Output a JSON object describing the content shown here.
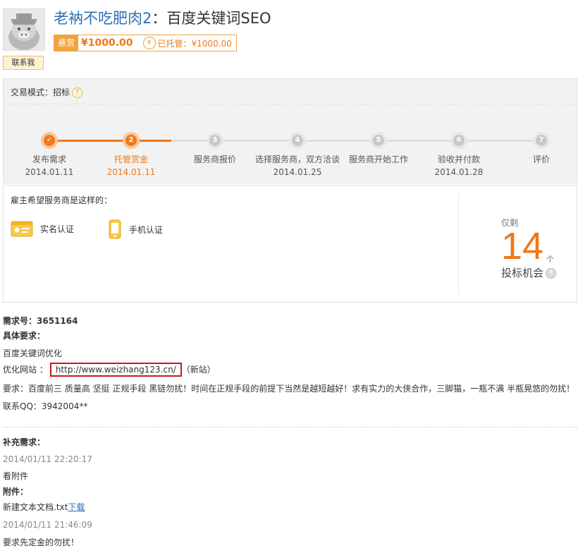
{
  "header": {
    "username": "老衲不吃肥肉2",
    "title_sep": "：",
    "task_title": "百度关键词SEO",
    "contact_label": "联系我",
    "reward_tag": "悬赏",
    "reward_amount": "¥1000.00",
    "escrow_icon_char": "¥",
    "escrow_text": "已托管：¥1000.00"
  },
  "process": {
    "mode_label": "交易模式：招标",
    "steps": [
      {
        "num": "✓",
        "label": "发布需求",
        "date": "2014.01.11",
        "state": "done"
      },
      {
        "num": "2",
        "label": "托管赏金",
        "date": "2014.01.11",
        "state": "active"
      },
      {
        "num": "3",
        "label": "服务商报价",
        "date": "",
        "state": "pending"
      },
      {
        "num": "4",
        "label": "选择服务商，双方洽谈",
        "date": "2014.01.25",
        "state": "pending"
      },
      {
        "num": "5",
        "label": "服务商开始工作",
        "date": "",
        "state": "pending"
      },
      {
        "num": "6",
        "label": "验收并付款",
        "date": "2014.01.28",
        "state": "pending"
      },
      {
        "num": "7",
        "label": "评价",
        "date": "",
        "state": "pending"
      }
    ]
  },
  "requirements": {
    "heading": "雇主希望服务商是这样的：",
    "certs": [
      {
        "label": "实名认证",
        "icon": "id-card-icon"
      },
      {
        "label": "手机认证",
        "icon": "mobile-phone-icon"
      }
    ],
    "bid": {
      "only": "仅剩",
      "count": "14",
      "unit": "个",
      "chance": "投标机会"
    }
  },
  "detail": {
    "req_no": "需求号：3651164",
    "specific_heading": "具体要求：",
    "line1": "百度关键词优化",
    "site_label": "优化网站 ：",
    "site_url": "http://www.weizhang123.cn/",
    "site_note": "（新站）",
    "line3": "要求：百度前三 质量高  坚挺 正规手段  黑链勿扰！时间在正规手段的前提下当然是越短越好！求有实力的大侠合作，三脚猫，一瓶不满 半瓶晃悠的勿扰！",
    "qq": "联系QQ：3942004**"
  },
  "supplement": {
    "heading": "补充需求：",
    "entries": [
      {
        "time": "2014/01/11 22:20:17",
        "text": "看附件"
      },
      {
        "time": "2014/01/11 21:46:09",
        "text": "要求先定金的勿扰！"
      }
    ],
    "attach_heading": "附件：",
    "attach_file": "新建文本文档.txt",
    "download": "下载"
  },
  "colors": {
    "accent": "#f07818",
    "link": "#2f6fb5",
    "highlight_border": "#c8181e"
  }
}
